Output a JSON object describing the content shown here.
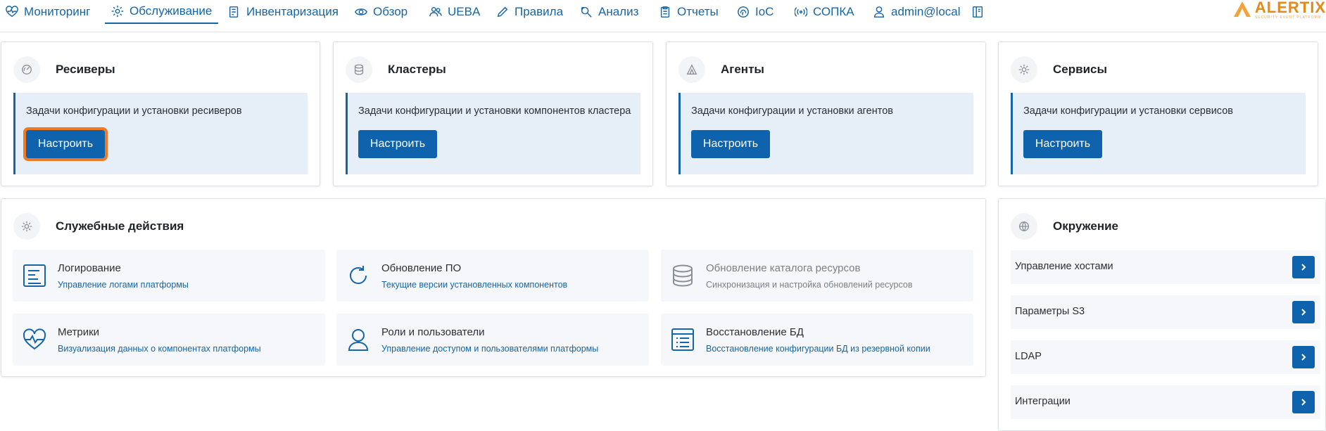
{
  "nav": {
    "items": [
      {
        "label": "Мониторинг",
        "icon": "heartbeat-icon"
      },
      {
        "label": "Обслуживание",
        "icon": "gear-icon",
        "active": true
      },
      {
        "label": "Инвентаризация",
        "icon": "edit-list-icon"
      },
      {
        "label": "Обзор",
        "icon": "eye-icon"
      },
      {
        "label": "UEBA",
        "icon": "users-icon"
      },
      {
        "label": "Правила",
        "icon": "pencil-icon"
      },
      {
        "label": "Анализ",
        "icon": "magnifier-icon"
      },
      {
        "label": "Отчеты",
        "icon": "clipboard-icon"
      },
      {
        "label": "IoC",
        "icon": "fingerprint-icon"
      },
      {
        "label": "СОПКА",
        "icon": "broadcast-icon"
      },
      {
        "label": "admin@local",
        "icon": "user-icon"
      }
    ],
    "extra_icon": "book-icon"
  },
  "logo": {
    "text": "ALERTIX",
    "sub": "SECURITY EVENT PLATFORM"
  },
  "accent": "#0f63ad",
  "cards": [
    {
      "title": "Ресиверы",
      "icon": "receiver-icon",
      "desc": "Задачи конфигурации и установки ресиверов",
      "button": "Настроить",
      "focused": true
    },
    {
      "title": "Кластеры",
      "icon": "database-icon",
      "desc": "Задачи конфигурации и установки компонентов кластера",
      "button": "Настроить"
    },
    {
      "title": "Агенты",
      "icon": "agent-icon",
      "desc": "Задачи конфигурации и установки агентов",
      "button": "Настроить"
    },
    {
      "title": "Сервисы",
      "icon": "gear-icon",
      "desc": "Задачи конфигурации и установки сервисов",
      "button": "Настроить"
    }
  ],
  "service": {
    "title": "Служебные действия",
    "tiles": [
      {
        "title": "Логирование",
        "sub": "Управление логами платформы",
        "icon": "log-icon"
      },
      {
        "title": "Обновление ПО",
        "sub": "Текущие версии установленных компонентов",
        "icon": "refresh-icon"
      },
      {
        "title": "Обновление каталога ресурсов",
        "sub": "Синхронизация и настройка обновлений ресурсов",
        "icon": "database-icon",
        "disabled": true
      },
      {
        "title": "Метрики",
        "sub": "Визуализация данных о компонентах платформы",
        "icon": "heart-pulse-icon"
      },
      {
        "title": "Роли и пользователи",
        "sub": "Управление доступом и пользователями платформы",
        "icon": "user-icon"
      },
      {
        "title": "Восстановление БД",
        "sub": "Восстановление конфигурации БД из резервной копии",
        "icon": "list-icon"
      }
    ]
  },
  "environment": {
    "title": "Окружение",
    "items": [
      {
        "label": "Управление хостами"
      },
      {
        "label": "Параметры S3"
      },
      {
        "label": "LDAP"
      },
      {
        "label": "Интеграции"
      }
    ]
  }
}
